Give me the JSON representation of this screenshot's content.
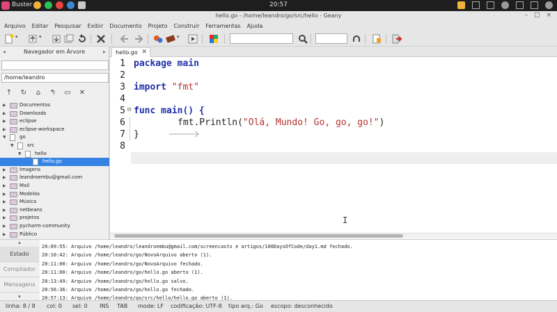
{
  "panel": {
    "app_name": "Buster",
    "clock": "20:57"
  },
  "window": {
    "title": "hello.go - /home/leandro/go/src/hello - Geany",
    "minimize": "–",
    "maximize": "□",
    "close": "×"
  },
  "menu": [
    "Arquivo",
    "Editar",
    "Pesquisar",
    "Exibir",
    "Documento",
    "Projeto",
    "Construir",
    "Ferramentas",
    "Ajuda"
  ],
  "sidebar": {
    "title": "Navegador em Árvore",
    "filter_value": "",
    "path_value": "/home/leandro",
    "tree": [
      {
        "label": "Documentos",
        "type": "folder",
        "level": 0,
        "expanded": false,
        "selected": false
      },
      {
        "label": "Downloads",
        "type": "folder",
        "level": 0,
        "expanded": false,
        "selected": false
      },
      {
        "label": "eclipse",
        "type": "folder",
        "level": 0,
        "expanded": false,
        "selected": false
      },
      {
        "label": "eclipse-workspace",
        "type": "folder",
        "level": 0,
        "expanded": false,
        "selected": false
      },
      {
        "label": "go",
        "type": "file",
        "level": 0,
        "expanded": true,
        "selected": false
      },
      {
        "label": "src",
        "type": "file",
        "level": 1,
        "expanded": true,
        "selected": false
      },
      {
        "label": "hello",
        "type": "file",
        "level": 2,
        "expanded": true,
        "selected": false
      },
      {
        "label": "hello.go",
        "type": "file",
        "level": 3,
        "expanded": null,
        "selected": true
      },
      {
        "label": "Imagens",
        "type": "folder",
        "level": 0,
        "expanded": false,
        "selected": false
      },
      {
        "label": "leandroembu@gmail.com",
        "type": "folder",
        "level": 0,
        "expanded": false,
        "selected": false
      },
      {
        "label": "Mail",
        "type": "folder",
        "level": 0,
        "expanded": false,
        "selected": false
      },
      {
        "label": "Modelos",
        "type": "folder",
        "level": 0,
        "expanded": false,
        "selected": false
      },
      {
        "label": "Música",
        "type": "folder",
        "level": 0,
        "expanded": false,
        "selected": false
      },
      {
        "label": "netbeans",
        "type": "folder",
        "level": 0,
        "expanded": false,
        "selected": false
      },
      {
        "label": "projetos",
        "type": "folder",
        "level": 0,
        "expanded": false,
        "selected": false
      },
      {
        "label": "pycharm-community",
        "type": "folder",
        "level": 0,
        "expanded": false,
        "selected": false
      },
      {
        "label": "Público",
        "type": "folder",
        "level": 0,
        "expanded": false,
        "selected": false
      }
    ]
  },
  "editor": {
    "tab_label": "hello.go",
    "line_numbers": [
      "1",
      "2",
      "3",
      "4",
      "5",
      "6",
      "7",
      "8"
    ],
    "code": {
      "l1_kw": "package",
      "l1_name": " main",
      "l3_kw": "import",
      "l3_str": " \"fmt\"",
      "l5_kw": "func",
      "l5_name": " main() {",
      "l6_call": "fmt.Println(",
      "l6_str": "\"Olá, Mundo! Go, go, go!\"",
      "l6_end": ")",
      "l7": "}"
    }
  },
  "messages_tabs": [
    "Estado",
    "Compilador",
    "Mensagens"
  ],
  "messages": [
    "20:09:55: Arquivo /home/leandro/leandroembu@gmail.com/screencasts e artigos/100DaysOfCode/day1.md fechado.",
    "20:10:42: Arquivo /home/leandro/go/NovoArquivo aberto (1).",
    "20:11:00: Arquivo /home/leandro/go/NovoArquivo fechado.",
    "20:11:00: Arquivo /home/leandro/go/hello.go aberto (1).",
    "20:13:49: Arquivo /home/leandro/go/hello.go salvo.",
    "20:56:36: Arquivo /home/leandro/go/hello.go fechado.",
    "20:57:13: Arquivo /home/leandro/go/src/hello/hello.go aberto (1)."
  ],
  "status": {
    "line": "linha: 8 / 8",
    "col": "col: 0",
    "sel": "sel: 0",
    "ins": "INS",
    "tab": "TAB",
    "mode": "mode: LF",
    "encoding": "codificação: UTF-8",
    "filetype": "tipo arq.: Go",
    "scope": "escopo: desconhecido"
  },
  "colors": {
    "keyword": "#1f2fa8",
    "string": "#b5312c",
    "selection": "#3584e4"
  }
}
